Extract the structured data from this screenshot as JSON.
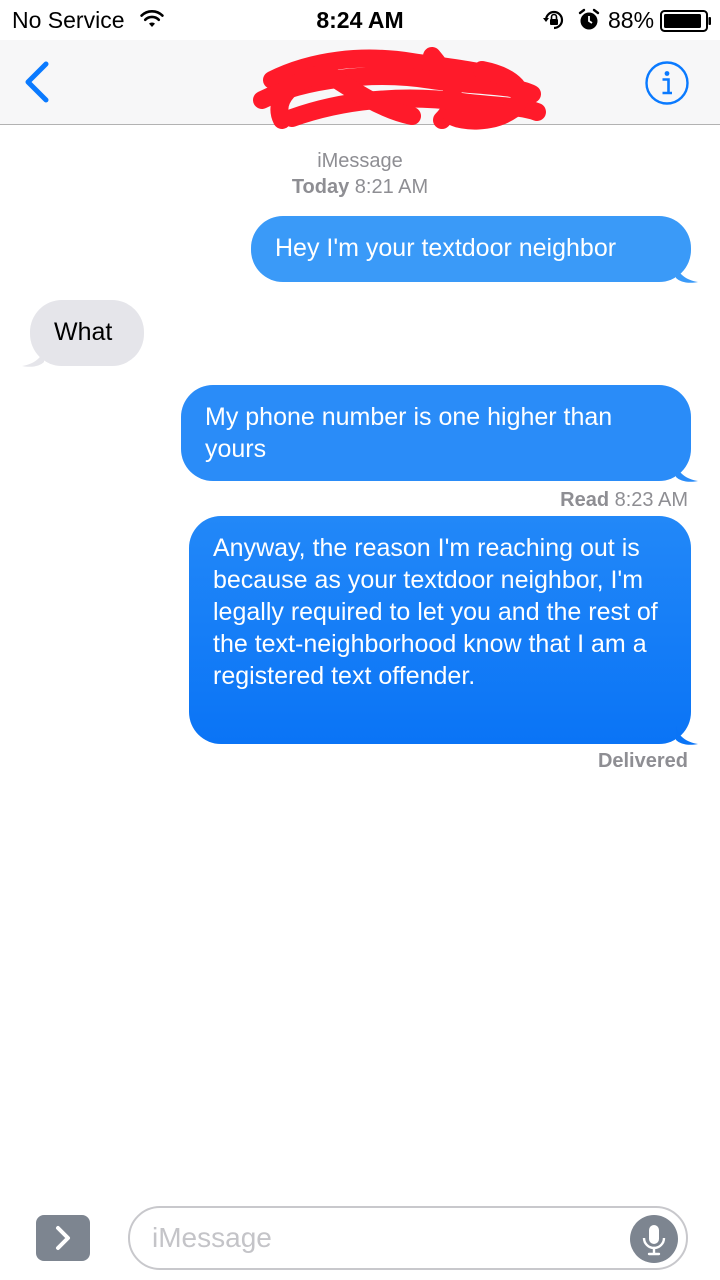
{
  "status_bar": {
    "carrier": "No Service",
    "time": "8:24 AM",
    "battery": "88%",
    "icons": [
      "wifi-icon",
      "rotation-lock-icon",
      "alarm-icon",
      "battery-icon"
    ]
  },
  "nav": {
    "back_icon": "chevron-left-icon",
    "contact_visible": "(",
    "contact_redacted": true,
    "info_icon": "info-icon"
  },
  "thread": {
    "service": "iMessage",
    "day": "Today",
    "time": "8:21 AM"
  },
  "messages": [
    {
      "direction": "outgoing",
      "text": "Hey I'm your textdoor neighbor"
    },
    {
      "direction": "incoming",
      "text": "What"
    },
    {
      "direction": "outgoing",
      "text": "My phone number is one higher than yours"
    },
    {
      "direction": "outgoing",
      "text": "Anyway, the reason I'm reaching out is because as your textdoor neighbor, I'm legally required to let you and the rest of the text-neighborhood know that I am a registered text offender."
    }
  ],
  "receipts": {
    "read_label": "Read",
    "read_time": "8:23 AM",
    "delivered": "Delivered"
  },
  "compose": {
    "placeholder": "iMessage",
    "expand_icon": "chevron-right-icon",
    "mic_icon": "microphone-icon"
  },
  "colors": {
    "accent": "#0a7aff",
    "outgoing_bubble": "#1a80f7",
    "incoming_bubble": "#e5e5ea",
    "redaction": "#ff1a2a"
  }
}
